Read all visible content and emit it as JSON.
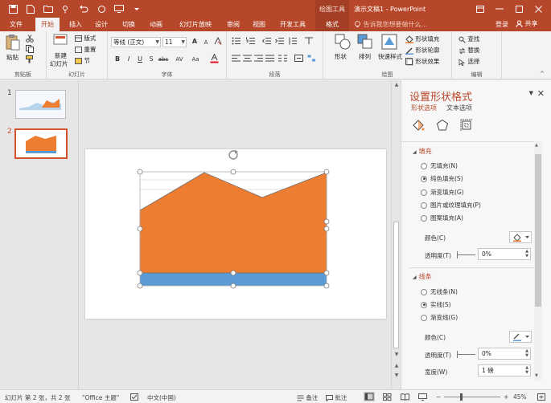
{
  "window": {
    "title": "演示文稿1 - PowerPoint",
    "context_tab_title": "绘图工具"
  },
  "tabs": [
    "文件",
    "开始",
    "插入",
    "设计",
    "切换",
    "动画",
    "幻灯片放映",
    "审阅",
    "视图",
    "开发工具",
    "格式"
  ],
  "active_tab": "开始",
  "tell_me": "告诉我您想要做什么...",
  "login": "登录",
  "share": "共享",
  "ribbon": {
    "clipboard": {
      "label": "剪贴板",
      "paste": "粘贴"
    },
    "slides": {
      "label": "幻灯片",
      "new_slide": "新建",
      "new_slide2": "幻灯片",
      "layout": "版式",
      "reset": "重置",
      "section": "节"
    },
    "font": {
      "label": "字体",
      "font_name": "等线 (正文)",
      "font_size": "11"
    },
    "paragraph": {
      "label": "段落"
    },
    "drawing": {
      "label": "绘图",
      "shapes": "形状",
      "arrange": "排列",
      "quick_styles": "快速样式",
      "fill": "形状填充",
      "outline": "形状轮廓",
      "effects": "形状效果"
    },
    "editing": {
      "label": "编辑",
      "find": "查找",
      "replace": "替换",
      "select": "选择"
    }
  },
  "slides": [
    {
      "number": "1"
    },
    {
      "number": "2"
    }
  ],
  "pane": {
    "title": "设置形状格式",
    "tab_shape": "形状选项",
    "tab_text": "文本选项",
    "fill": {
      "header": "填充",
      "options": [
        "无填充(N)",
        "纯色填充(S)",
        "渐变填充(G)",
        "图片或纹理填充(P)",
        "图案填充(A)"
      ],
      "selected": 1,
      "color_label": "颜色(C)",
      "transparency_label": "透明度(T)",
      "transparency_value": "0%"
    },
    "line": {
      "header": "线条",
      "options": [
        "无线条(N)",
        "实线(S)",
        "渐变线(G)"
      ],
      "selected": 1,
      "color_label": "颜色(C)",
      "transparency_label": "透明度(T)",
      "transparency_value": "0%",
      "width_label": "宽度(W)",
      "width_value": "1 磅"
    }
  },
  "status": {
    "slide_info": "幻灯片 第 2 张，共 2 张",
    "theme": "\"Office 主题\"",
    "language": "中文(中国)",
    "notes": "备注",
    "comments": "批注",
    "zoom": "45%"
  },
  "colors": {
    "accent": "#b7472a",
    "shape_orange": "#ed7d31",
    "shape_blue": "#5b9bd5"
  }
}
